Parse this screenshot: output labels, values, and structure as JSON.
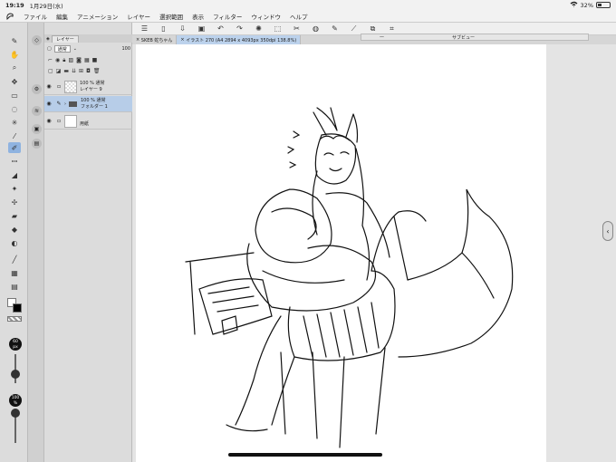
{
  "status": {
    "time": "19:19",
    "date": "1月29日(水)",
    "wifi_icon": "wifi-icon",
    "battery_percent": "32%",
    "battery_level": 0.32
  },
  "menu": {
    "items": [
      "ファイル",
      "編集",
      "アニメーション",
      "レイヤー",
      "選択範囲",
      "表示",
      "フィルター",
      "ウィンドウ",
      "ヘルプ"
    ]
  },
  "commands": [
    "menu-icon",
    "new-icon",
    "open-icon",
    "save-icon",
    "undo-icon",
    "redo-icon",
    "settings-icon",
    "transform-icon",
    "cut-icon",
    "fill-icon",
    "pen-icon",
    "brush-icon",
    "copy-icon",
    "crop-icon"
  ],
  "subview": {
    "title": "サブビュー",
    "minimize": "—"
  },
  "layer_panel": {
    "tab_label": "レイヤー",
    "blend_mode": "通常",
    "opacity": "100",
    "layers": [
      {
        "line1": "100 % 通常",
        "line2": "レイヤー 9"
      },
      {
        "line1": "100 % 通常",
        "line2": "フォルダー 1"
      },
      {
        "line1": "",
        "line2": "用紙"
      }
    ]
  },
  "doc_tabs": [
    {
      "label": "SKEB 蛇ちゃん"
    },
    {
      "label": "イラスト 270 (A4 2894 x 4093px 350dpi 138.8%)"
    }
  ],
  "brush": {
    "size_label": "60",
    "size_unit": "px",
    "opacity_label": "100",
    "opacity_unit": "%"
  },
  "colors": {
    "accent": "#8fb3e0",
    "selected_layer": "#b7cde8",
    "active_tab": "#bcd2ec"
  }
}
